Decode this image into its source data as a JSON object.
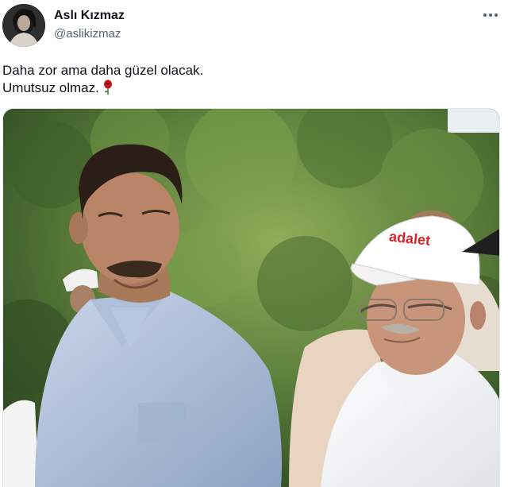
{
  "author": {
    "display_name": "Aslı Kızmaz",
    "handle": "@aslikizmaz",
    "avatar_icon": "profile-avatar"
  },
  "more_icon": "more-horizontal-icon",
  "tweet": {
    "line1": "Daha zor ama daha güzel olacak.",
    "line2": "Umutsuz olmaz.",
    "emoji": "rose"
  },
  "media": {
    "cap_text": "adalet"
  },
  "colors": {
    "text": "#0f1419",
    "secondary": "#536471",
    "foliage": "#5c7e3e",
    "cap_logo": "#d8232a"
  }
}
